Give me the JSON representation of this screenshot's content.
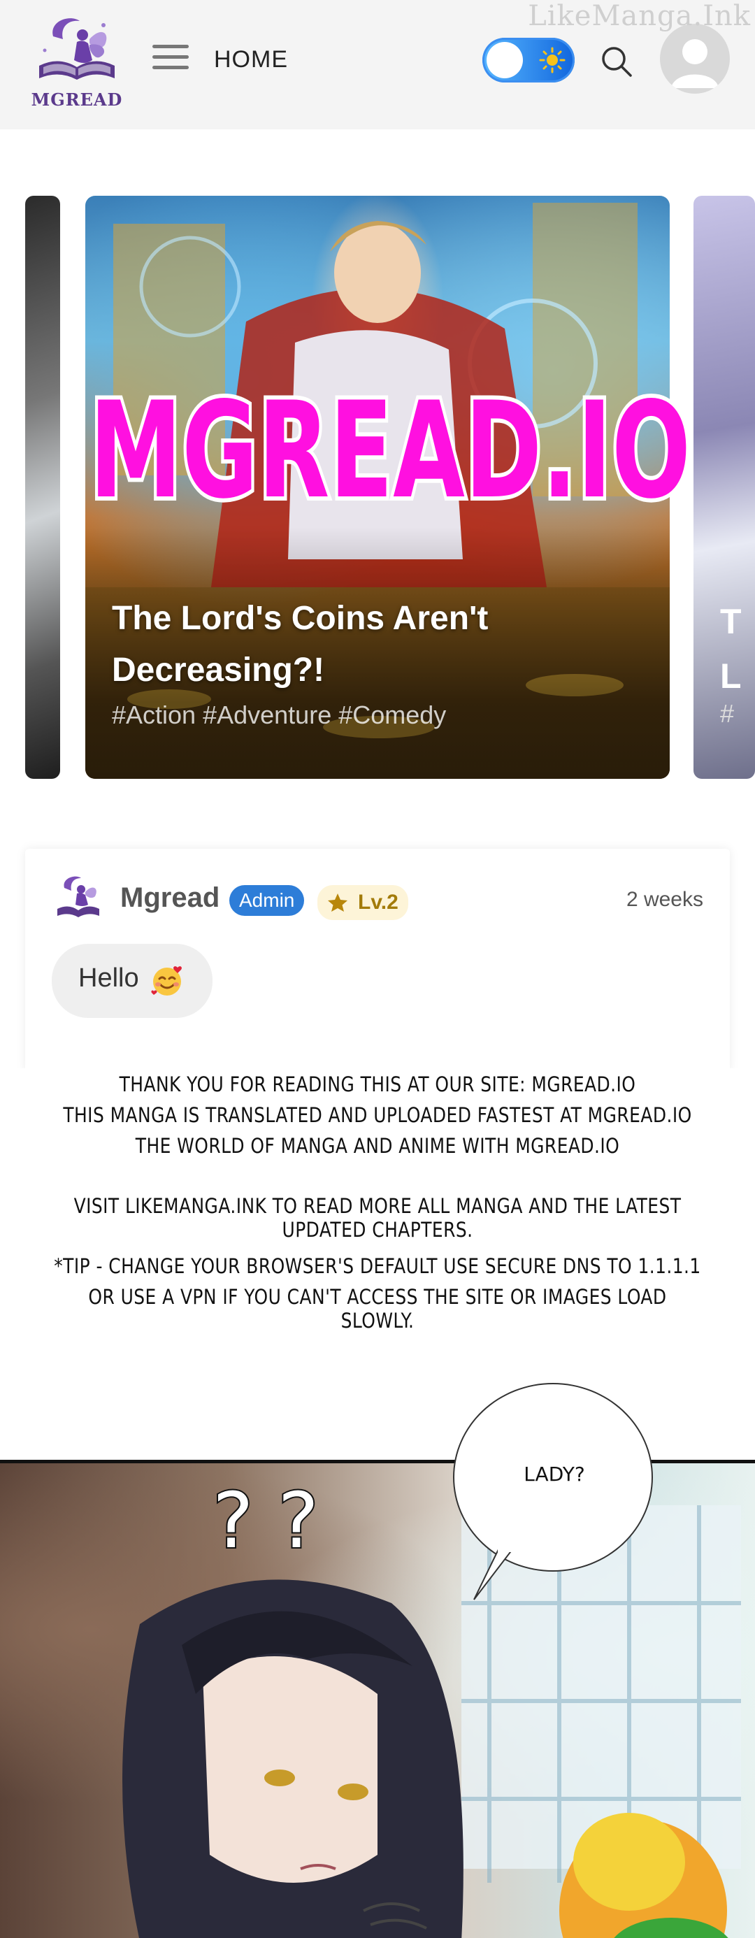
{
  "header": {
    "logo_text": "MGREAD",
    "home_label": "HOME",
    "watermark": "LikeManga.Ink"
  },
  "carousel": {
    "promo_text": "MGREAD.IO",
    "featured": {
      "title_line1": "The Lord's Coins Aren't",
      "title_line2": "Decreasing?!",
      "tags": "#Action #Adventure #Comedy"
    },
    "next": {
      "title_line1": "T",
      "title_line2": "L",
      "tags": "#"
    }
  },
  "comment": {
    "author": "Mgread",
    "role_badge": "Admin",
    "level_badge": "Lv.2",
    "time": "2 weeks",
    "message": "Hello"
  },
  "notice": {
    "line1": "Thank you for reading this at our site: mgread.io",
    "line2": "This manga is translated and uploaded fastest at mgread.io",
    "line3": "The world of manga and anime with mgread.io",
    "line4": "Visit likemanga.ink to read more all manga and the latest updated chapters.",
    "line5": "*Tip - Change your browser's default use secure DNS to 1.1.1.1",
    "line6": "or use a VPN if you can't access the site or images load slowly."
  },
  "panel": {
    "question_marks": "? ?",
    "speech": "LADY?"
  },
  "colors": {
    "accent": "#2d7dd8",
    "promo": "#ff10e0",
    "logo": "#5b3a8c",
    "level": "#a37b0a"
  }
}
